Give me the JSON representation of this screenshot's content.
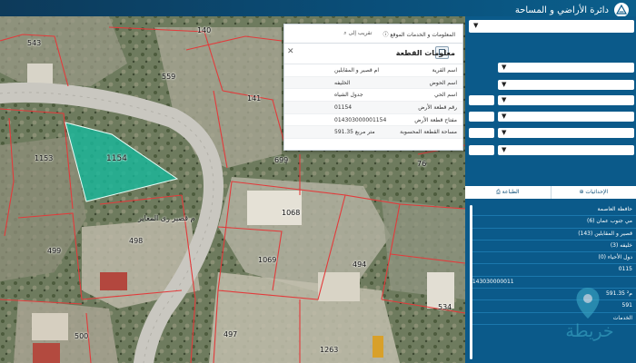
{
  "header": {
    "brand_title": "دائرة الأراضي و المساحة"
  },
  "map": {
    "selected_parcel_label": "1154",
    "parcel_labels": [
      "543",
      "140",
      "559",
      "141",
      "1153",
      "699",
      "76",
      "1068",
      "499",
      "498",
      "1069",
      "494",
      "534",
      "500",
      "497",
      "1263"
    ],
    "street_name": "م قصير رى المغاير"
  },
  "popup": {
    "tab_approach": "تقريب إلى",
    "tab_info": "المعلومات و الخدمات الموقع",
    "title": "معلومات القطعة",
    "rows": [
      {
        "label": "اسم القرية",
        "value": "ام قصير و المقابلين"
      },
      {
        "label": "اسم الحوض",
        "value": "الخليفه"
      },
      {
        "label": "اسم الحي",
        "value": "جدول الشياه"
      },
      {
        "label": "رقم قطعة الأرض",
        "value": "01154"
      },
      {
        "label": "مفتاح قطعة الأرض",
        "value": "014303000001154"
      },
      {
        "label": "مساحة القطعة المحسوبة",
        "value": "591.35 متر مربع"
      }
    ]
  },
  "panel": {
    "tab_print": "الطباعة",
    "tab_coordinates": "الإحداثيات",
    "results": [
      "حافظة العاصمة",
      "مي جنوب عمان (6)",
      "قصير و المقابلين (143)",
      "خليفه (3)",
      "دول الأحياء (0)",
      "0115",
      "0143030000011",
      "591.35 م²",
      "591",
      "الخدمات"
    ]
  },
  "watermark": {
    "text": "خريطة"
  },
  "colors": {
    "panel_bg": "#0b5a8a",
    "header_bg": "#0d3a5a",
    "parcel_outline": "#e23b3b",
    "selected_parcel_fill": "#18b79a"
  },
  "icons": [
    "close-icon",
    "copy-icon",
    "location-pin-icon",
    "print-icon",
    "coordinates-icon",
    "chevron-down-icon",
    "logo-icon"
  ]
}
